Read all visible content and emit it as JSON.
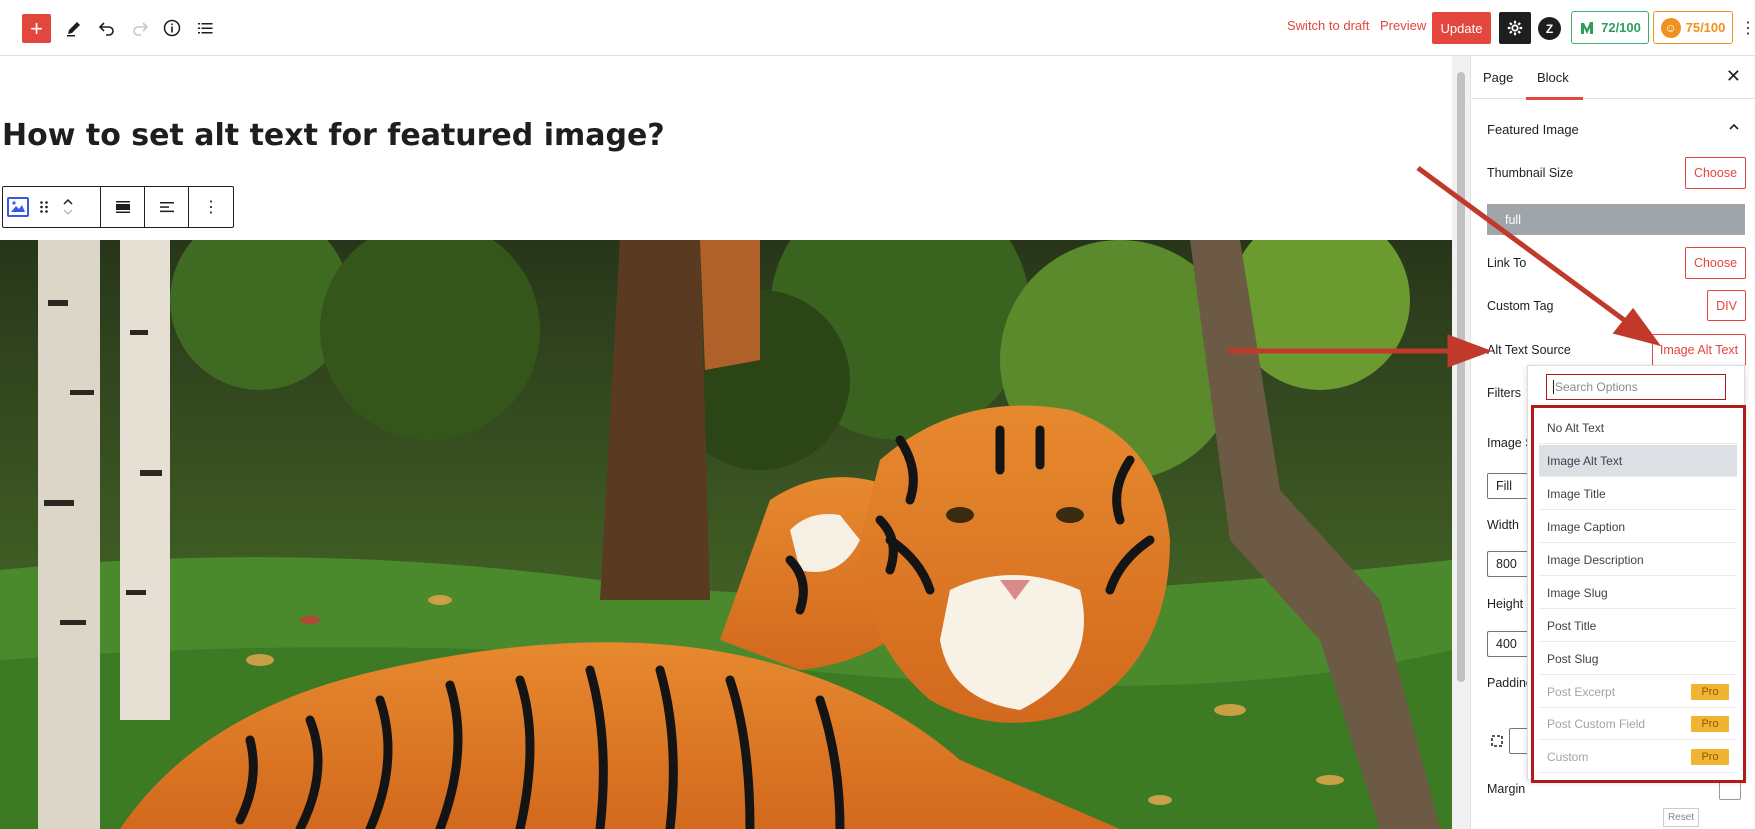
{
  "toolbar": {
    "add_label": "+",
    "switch_to_draft": "Switch to draft",
    "preview": "Preview",
    "update": "Update",
    "z_label": "Z",
    "score_1": "72/100",
    "score_2": "75/100",
    "colors": {
      "accent": "#e2463d",
      "score1": "#2d9e5d",
      "score2": "#f0901e"
    }
  },
  "editor": {
    "post_title": "How to set alt text for featured image?"
  },
  "sidebar": {
    "tabs": [
      {
        "label": "Page"
      },
      {
        "label": "Block"
      }
    ],
    "panel_title": "Featured Image",
    "thumbnail_size_label": "Thumbnail Size",
    "choose_label": "Choose",
    "full_label": "full",
    "link_to_label": "Link To",
    "link_choose_label": "Choose",
    "custom_tag_label": "Custom Tag",
    "custom_tag_value": "DIV",
    "alt_text_source_label": "Alt Text Source",
    "alt_text_source_value": "Image Alt Text",
    "filters_label": "Filters",
    "image_s_label": "Image S",
    "fill_value": "Fill",
    "width_label": "Width",
    "width_value": "800",
    "height_label": "Height",
    "height_value": "400",
    "padding_label": "Padding",
    "margin_label": "Margin",
    "reset_label": "Reset"
  },
  "dropdown": {
    "search_placeholder": "Search Options",
    "options": [
      {
        "label": "No Alt Text"
      },
      {
        "label": "Image Alt Text",
        "selected": true
      },
      {
        "label": "Image Title"
      },
      {
        "label": "Image Caption"
      },
      {
        "label": "Image Description"
      },
      {
        "label": "Image Slug"
      },
      {
        "label": "Post Title"
      },
      {
        "label": "Post Slug"
      },
      {
        "label": "Post Excerpt",
        "badge": "Pro"
      },
      {
        "label": "Post Custom Field",
        "badge": "Pro"
      },
      {
        "label": "Custom",
        "badge": "Pro"
      }
    ]
  }
}
